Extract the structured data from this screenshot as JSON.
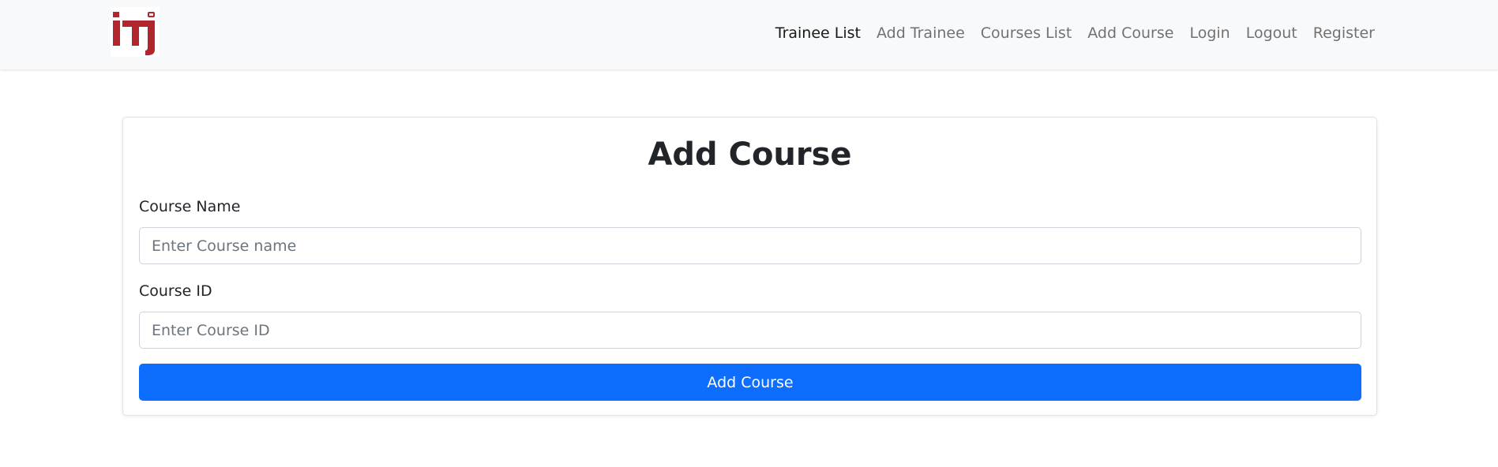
{
  "brand": {
    "logo_name": "iti-logo",
    "logo_color": "#b1252d"
  },
  "nav": {
    "items": [
      {
        "label": "Trainee List",
        "active": true
      },
      {
        "label": "Add Trainee"
      },
      {
        "label": "Courses List"
      },
      {
        "label": "Add Course"
      },
      {
        "label": "Login"
      },
      {
        "label": "Logout"
      },
      {
        "label": "Register"
      }
    ]
  },
  "form": {
    "title": "Add Course",
    "course_name_label": "Course Name",
    "course_name_placeholder": "Enter Course name",
    "course_id_label": "Course ID",
    "course_id_placeholder": "Enter Course ID",
    "submit_label": "Add Course",
    "submit_color": "#0d6efd"
  }
}
